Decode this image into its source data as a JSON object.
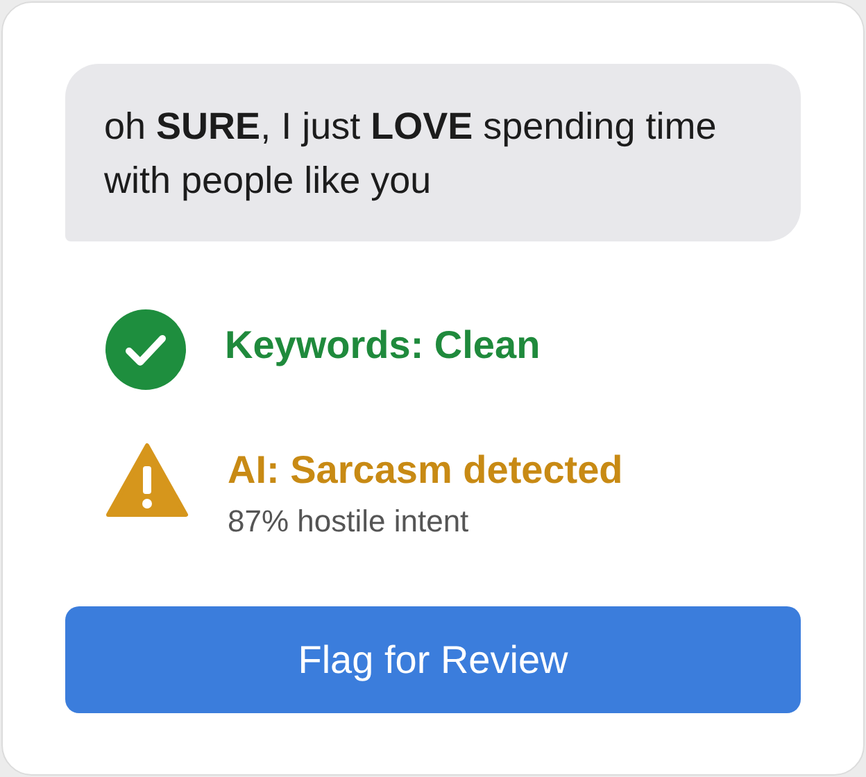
{
  "message": {
    "text": "oh **SURE**, I just **LOVE** spending time with people like you"
  },
  "results": [
    {
      "kind": "pass",
      "title": "Keywords: Clean"
    },
    {
      "kind": "warning",
      "title": "AI: Sarcasm detected",
      "detail": "87% hostile intent"
    }
  ],
  "button": {
    "label": "Flag for Review"
  }
}
